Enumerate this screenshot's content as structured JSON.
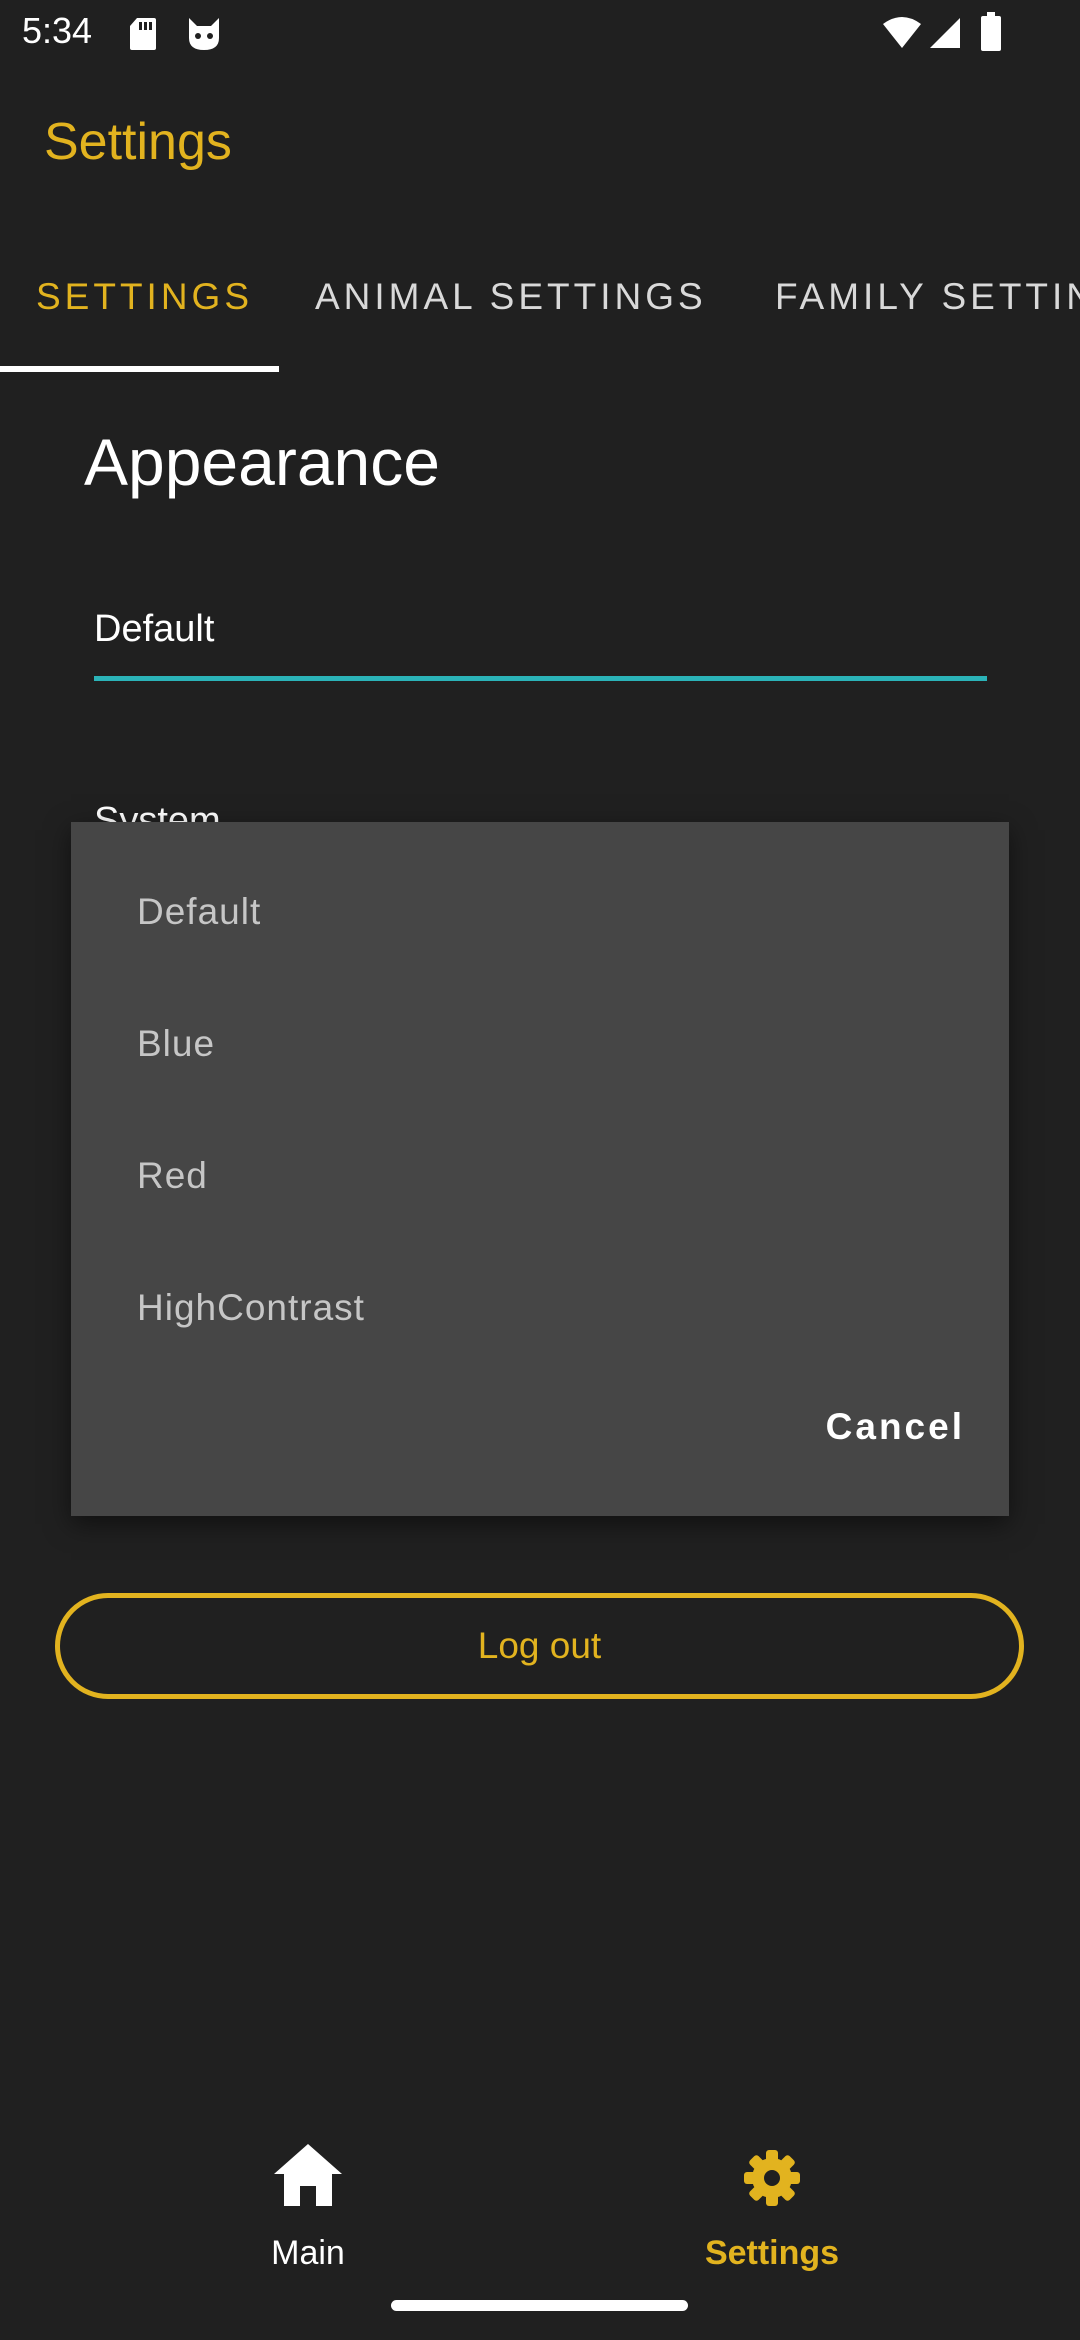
{
  "status_bar": {
    "time": "5:34",
    "left_icons": [
      "sd-card-icon",
      "cat-notification-icon"
    ],
    "right_icons": [
      "wifi-icon",
      "cellular-signal-icon",
      "battery-icon"
    ]
  },
  "app_bar": {
    "title": "Settings"
  },
  "tabs": [
    {
      "label": "SETTINGS",
      "active": true
    },
    {
      "label": "ANIMAL SETTINGS",
      "active": false
    },
    {
      "label": "FAMILY SETTIN",
      "active": false
    }
  ],
  "appearance": {
    "title": "Appearance",
    "theme_value": "Default",
    "mode_label": "System"
  },
  "dialog": {
    "options": [
      "Default",
      "Blue",
      "Red",
      "HighContrast"
    ],
    "cancel_label": "Cancel"
  },
  "logout_label": "Log out",
  "bottom_nav": [
    {
      "label": "Main",
      "icon": "home-icon",
      "active": false
    },
    {
      "label": "Settings",
      "icon": "gear-icon",
      "active": true
    }
  ],
  "colors": {
    "background": "#202020",
    "accent": "#e2b31f",
    "field_underline": "#2bb3b8",
    "dialog_background": "#464646"
  }
}
